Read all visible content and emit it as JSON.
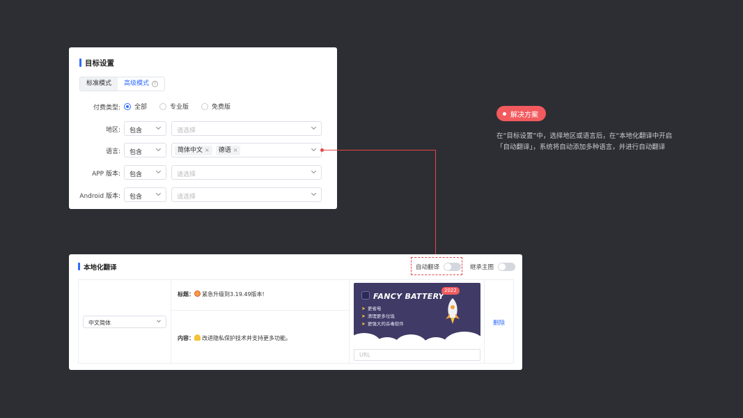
{
  "target_settings": {
    "title": "目标设置",
    "tabs": [
      {
        "label": "标准模式"
      },
      {
        "label": "高级模式"
      }
    ],
    "pay_type": {
      "label": "付费类型:",
      "options": [
        "全部",
        "专业版",
        "免费版"
      ],
      "selected": "全部"
    },
    "region": {
      "label": "地区:",
      "operator": "包含",
      "placeholder": "请选择"
    },
    "language": {
      "label": "语言:",
      "operator": "包含",
      "tags": [
        "简体中文",
        "德语"
      ]
    },
    "app_version": {
      "label": "APP 版本:",
      "operator": "包含",
      "placeholder": "请选择"
    },
    "android_version": {
      "label": "Android 版本:",
      "operator": "包含",
      "placeholder": "请选择"
    }
  },
  "solution": {
    "badge": "解决方案",
    "description": "在“目标设置”中，选择地区或语言后，在“本地化翻译中开启「自动翻译」，系统将自动添加多种语言，并进行自动翻译"
  },
  "localization": {
    "title": "本地化翻译",
    "auto_translate_label": "自动翻译",
    "auto_translate_on": false,
    "inherit_theme_label": "继承主图",
    "inherit_theme_on": false,
    "row": {
      "language": "中文简体",
      "title_label": "标题：",
      "title_value": "紧急升级到3.19.49版本!",
      "content_label": "内容：",
      "content_value": "改进隐私保护技术并支持更多功能。",
      "banner": {
        "title": "FANCY BATTERY",
        "year": "2022",
        "bullets": [
          "更省电",
          "清理更多垃圾",
          "更强大的杀毒软件"
        ]
      },
      "url_placeholder": "URL",
      "delete_label": "删除"
    }
  },
  "colors": {
    "accent": "#2f6bff",
    "highlight": "#f25a5e",
    "background": "#2d2e33"
  }
}
